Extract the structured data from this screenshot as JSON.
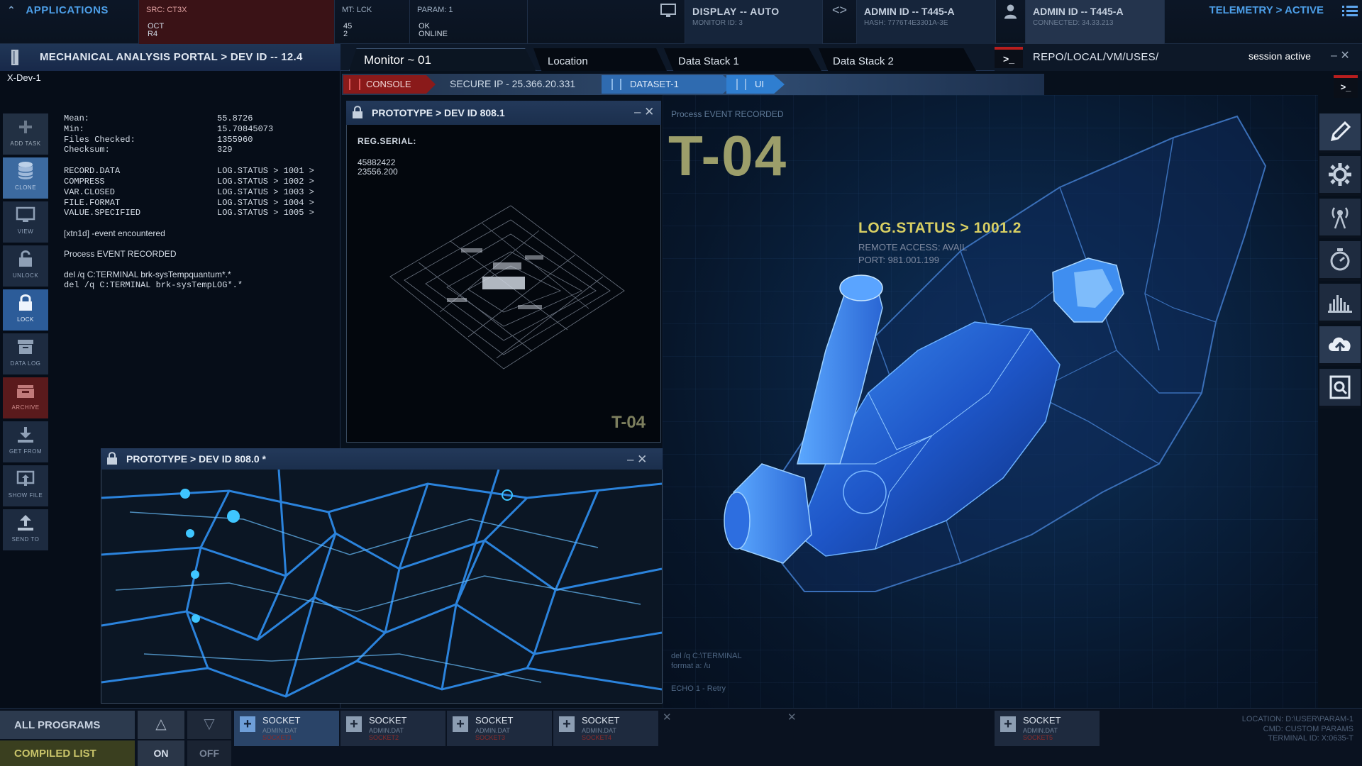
{
  "topbar": {
    "applications": "APPLICATIONS",
    "src_label": "SRC: CT3X",
    "src_sub1": "OCT",
    "src_sub2": "R4",
    "mt_label": "MT: LCK",
    "mt_sub1": "45",
    "mt_sub2": "2",
    "param_label": "PARAM: 1",
    "param_sub1": "OK",
    "param_sub2": "ONLINE",
    "display": "DISPLAY -- AUTO",
    "display_sub": "MONITOR ID: 3",
    "admin1": "ADMIN ID -- T445-A",
    "admin1_sub": "HASH: 7776T4E3301A-3E",
    "admin2": "ADMIN ID -- T445-A",
    "admin2_sub": "CONNECTED: 34.33.213",
    "telemetry": "TELEMETRY > ACTIVE"
  },
  "portal": {
    "title": "MECHANICAL ANALYSIS PORTAL > DEV ID -- 12.4",
    "tabs": [
      {
        "label": "Monitor ~ 01"
      },
      {
        "label": "Location"
      },
      {
        "label": "Data Stack 1"
      },
      {
        "label": "Data Stack 2"
      }
    ],
    "term_prompt": ">_",
    "repo_path": "REPO/LOCAL/VM/USES/",
    "session": "session active",
    "session_ctrls": "– ✕"
  },
  "left": {
    "device": "X-Dev-1",
    "stats": [
      {
        "k": "Mean:",
        "v": "55.8726"
      },
      {
        "k": "Min:",
        "v": "15.70845073"
      },
      {
        "k": "Files Checked:",
        "v": "1355960"
      },
      {
        "k": "Checksum:",
        "v": "329"
      }
    ],
    "records": [
      {
        "k": "RECORD.DATA",
        "v": "LOG.STATUS > 1001 >"
      },
      {
        "k": "COMPRESS",
        "v": "LOG.STATUS > 1002 >"
      },
      {
        "k": "VAR.CLOSED",
        "v": "LOG.STATUS > 1003 >"
      },
      {
        "k": "FILE.FORMAT",
        "v": "LOG.STATUS > 1004 >"
      },
      {
        "k": "VALUE.SPECIFIED",
        "v": "LOG.STATUS > 1005 >"
      }
    ],
    "event": "[xtn1d] -event encountered",
    "process": "Process EVENT RECORDED",
    "del1": "del /q C:TERMINAL brk-sysTempquantum*.*",
    "del2": "del /q C:TERMINAL brk-sysTempLOG*.*"
  },
  "sidebar": [
    {
      "label": "ADD TASK",
      "icon": "plus-icon"
    },
    {
      "label": "CLONE",
      "icon": "database-icon"
    },
    {
      "label": "VIEW",
      "icon": "monitor-icon"
    },
    {
      "label": "UNLOCK",
      "icon": "unlock-icon"
    },
    {
      "label": "LOCK",
      "icon": "lock-icon"
    },
    {
      "label": "DATA LOG",
      "icon": "archive-box-icon"
    },
    {
      "label": "ARCHIVE",
      "icon": "archive-icon"
    },
    {
      "label": "GET FROM",
      "icon": "download-icon"
    },
    {
      "label": "SHOW FILE",
      "icon": "show-file-icon"
    },
    {
      "label": "SEND TO",
      "icon": "upload-icon"
    }
  ],
  "console": {
    "console_label": "CONSOLE",
    "secure_ip": "SECURE IP - 25.366.20.331",
    "dataset": "DATASET-1",
    "ui": "UI"
  },
  "window1": {
    "title": "PROTOTYPE > DEV ID 808.1",
    "reg_serial": "REG.SERIAL:",
    "num1": "45882422",
    "num2": "23556.200",
    "label": "T-04",
    "ctrls": "– ✕"
  },
  "window2": {
    "title": "PROTOTYPE > DEV ID 808.0 *",
    "ctrls": "– ✕"
  },
  "main": {
    "process": "Process EVENT RECORDED",
    "big_label": "T-04",
    "log_status": "LOG.STATUS > 1001.2",
    "remote": "REMOTE ACCESS: AVAIL",
    "port": "PORT: 981.001.199",
    "cmd1": "del /q C:\\TERMINAL",
    "cmd2": "format a: /u",
    "cmd3": "ECHO 1 - Retry"
  },
  "right_toolbar": {
    "term_prompt": ">_",
    "icons": [
      "pencil-icon",
      "gear-icon",
      "antenna-icon",
      "timer-icon",
      "chart-icon",
      "cloud-upload-icon",
      "search-file-icon"
    ]
  },
  "bottom": {
    "all_programs": "ALL PROGRAMS",
    "compiled_list": "COMPILED LIST",
    "up": "△",
    "down": "▽",
    "on": "ON",
    "off": "OFF",
    "sockets": [
      {
        "name": "SOCKET",
        "sub": "ADMIN.DAT",
        "red": "SOCKET1"
      },
      {
        "name": "SOCKET",
        "sub": "ADMIN.DAT",
        "red": "SOCKET2"
      },
      {
        "name": "SOCKET",
        "sub": "ADMIN.DAT",
        "red": "SOCKET3"
      },
      {
        "name": "SOCKET",
        "sub": "ADMIN.DAT",
        "red": "SOCKET4"
      },
      {
        "name": "SOCKET",
        "sub": "ADMIN.DAT",
        "red": "SOCKET5"
      }
    ],
    "location": "LOCATION: D:\\USER\\PARAM-1",
    "cmd": "CMD: CUSTOM PARAMS",
    "terminal": "TERMINAL ID: X:0635-T"
  },
  "colors": {
    "accent_blue": "#4d9fe8",
    "console_red": "#8a1a1a",
    "log_yellow": "#d8cf63"
  }
}
